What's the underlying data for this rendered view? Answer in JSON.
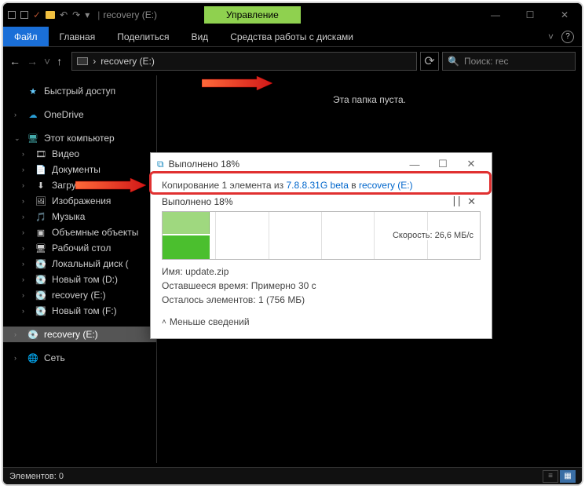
{
  "titlebar": {
    "location": "recovery (E:)",
    "manage": "Управление"
  },
  "ribbon": {
    "file": "Файл",
    "home": "Главная",
    "share": "Поделиться",
    "view": "Вид",
    "drivetools": "Средства работы с дисками"
  },
  "address": {
    "path": "recovery (E:)",
    "search_placeholder": "Поиск: rec",
    "search_icon_label": "🔍"
  },
  "sidebar": {
    "quick": "Быстрый доступ",
    "onedrive": "OneDrive",
    "thispc": "Этот компьютер",
    "items": [
      "Видео",
      "Документы",
      "Загрузки",
      "Изображения",
      "Музыка",
      "Объемные объекты",
      "Рабочий стол",
      "Локальный диск (",
      "Новый том (D:)",
      "recovery (E:)",
      "Новый том (F:)"
    ],
    "selected": "recovery (E:)",
    "network": "Сеть"
  },
  "content": {
    "empty": "Эта папка пуста."
  },
  "statusbar": {
    "count_label": "Элементов:",
    "count": "0"
  },
  "dialog": {
    "title_prefix": "Выполнено",
    "title_percent": "18%",
    "copy_prefix": "Копирование 1 элемента из",
    "copy_src": "7.8.8.31G beta",
    "copy_mid": "в",
    "copy_dst": "recovery (E:)",
    "done_line": "Выполнено 18%",
    "speed_label": "Скорость:",
    "speed_value": "26,6 МБ/с",
    "name_label": "Имя:",
    "name_value": "update.zip",
    "remain_label": "Оставшееся время:",
    "remain_value": "Примерно 30 с",
    "items_label": "Осталось элементов:",
    "items_value": "1 (756 МБ)",
    "less": "Меньше сведений"
  }
}
